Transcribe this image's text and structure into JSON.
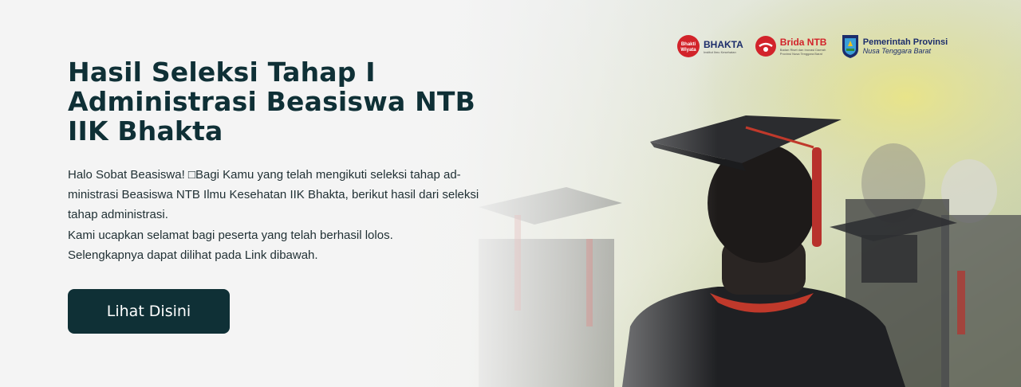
{
  "hero": {
    "title_line1": "Hasil Seleksi Tahap I",
    "title_line2": "Administrasi Beasiswa NTB",
    "title_line3": "IIK Bhakta",
    "desc_line1": "Halo Sobat Beasiswa! □Bagi Kamu yang telah mengikuti seleksi tahap ad-",
    "desc_line2": "ministrasi Beasiswa NTB Ilmu Kesehatan IIK Bhakta,  berikut hasil dari seleksi",
    "desc_line3": "tahap administrasi.",
    "desc_line4": "Kami ucapkan selamat bagi peserta yang telah berhasil lolos.",
    "desc_line5": "Selengkapnya dapat dilihat pada Link dibawah.",
    "cta_label": "Lihat Disini"
  },
  "logos": {
    "bhakta": {
      "badge": "Bhakti Wiyata",
      "name": "BHAKTA",
      "sub": "Institut Ilmu Kesehatan"
    },
    "brida": {
      "name": "Brida NTB",
      "sub": "Badan Riset dan Inovasi Daerah Provinsi Nusa Tenggara Barat"
    },
    "provinsi": {
      "line1": "Pemerintah Provinsi",
      "line2": "Nusa Tenggara Barat"
    }
  },
  "colors": {
    "brand_dark": "#0f3036",
    "logo_red": "#d2232a",
    "logo_navy": "#1c2d6b"
  }
}
